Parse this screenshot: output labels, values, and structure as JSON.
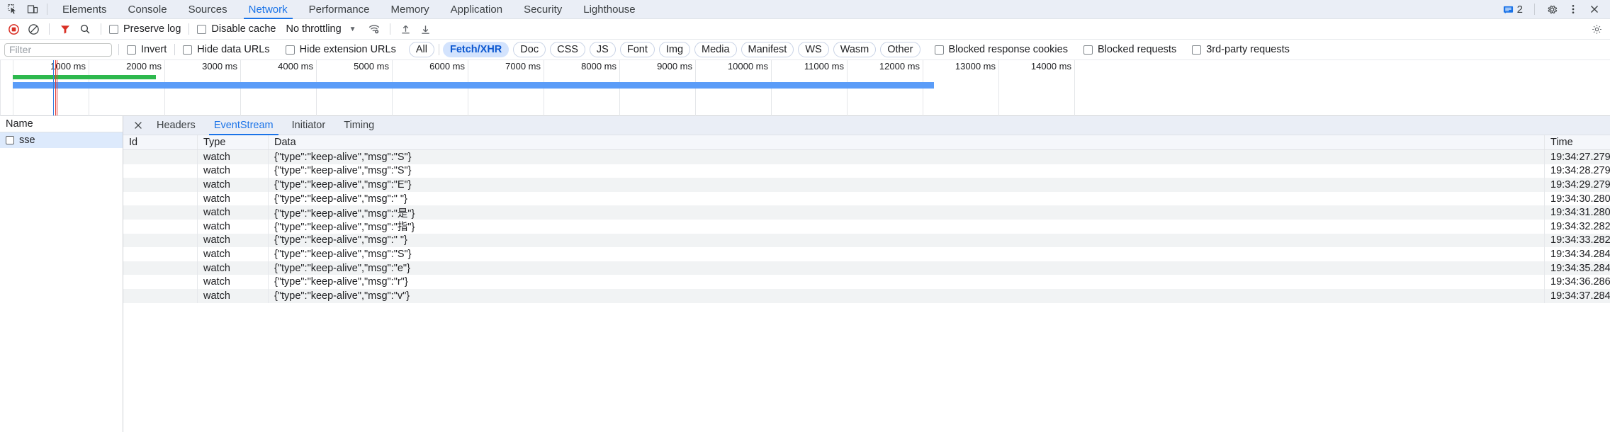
{
  "tabbar": {
    "inspect_icon": "inspect-element-icon",
    "device_icon": "device-toolbar-icon",
    "tabs": [
      {
        "label": "Elements",
        "active": false
      },
      {
        "label": "Console",
        "active": false
      },
      {
        "label": "Sources",
        "active": false
      },
      {
        "label": "Network",
        "active": true
      },
      {
        "label": "Performance",
        "active": false
      },
      {
        "label": "Memory",
        "active": false
      },
      {
        "label": "Application",
        "active": false
      },
      {
        "label": "Security",
        "active": false
      },
      {
        "label": "Lighthouse",
        "active": false
      }
    ],
    "message_count": "2",
    "message_icon": "console-message-icon",
    "settings_icon": "gear-icon",
    "more_icon": "kebab-menu-icon",
    "close_icon": "close-icon"
  },
  "toolbar": {
    "record_icon": "record-stop-icon",
    "clear_icon": "clear-network-log-icon",
    "filter_icon": "filter-icon",
    "search_icon": "search-icon",
    "preserve_log_label": "Preserve log",
    "preserve_log_checked": false,
    "disable_cache_label": "Disable cache",
    "disable_cache_checked": false,
    "throttling_value": "No throttling",
    "throttling_caret": "chevron-down-icon",
    "network_conditions_icon": "wifi-settings-icon",
    "import_icon": "import-har-icon",
    "export_icon": "export-har-icon",
    "settings_icon": "network-settings-gear-icon"
  },
  "filterbar": {
    "filter_value": "",
    "filter_placeholder": "Filter",
    "invert_label": "Invert",
    "invert_checked": false,
    "hide_data_urls_label": "Hide data URLs",
    "hide_data_urls_checked": false,
    "hide_extension_urls_label": "Hide extension URLs",
    "hide_extension_urls_checked": false,
    "types": [
      {
        "label": "All",
        "selected": false
      },
      {
        "label": "Fetch/XHR",
        "selected": true
      },
      {
        "label": "Doc",
        "selected": false
      },
      {
        "label": "CSS",
        "selected": false
      },
      {
        "label": "JS",
        "selected": false
      },
      {
        "label": "Font",
        "selected": false
      },
      {
        "label": "Img",
        "selected": false
      },
      {
        "label": "Media",
        "selected": false
      },
      {
        "label": "Manifest",
        "selected": false
      },
      {
        "label": "WS",
        "selected": false
      },
      {
        "label": "Wasm",
        "selected": false
      },
      {
        "label": "Other",
        "selected": false
      }
    ],
    "blocked_response_cookies_label": "Blocked response cookies",
    "blocked_response_cookies_checked": false,
    "blocked_requests_label": "Blocked requests",
    "blocked_requests_checked": false,
    "third_party_requests_label": "3rd-party requests",
    "third_party_requests_checked": false
  },
  "overview": {
    "ticks": [
      "1000 ms",
      "2000 ms",
      "3000 ms",
      "4000 ms",
      "5000 ms",
      "6000 ms",
      "7000 ms",
      "8000 ms",
      "9000 ms",
      "10000 ms",
      "11000 ms",
      "12000 ms",
      "13000 ms",
      "14000 ms"
    ],
    "colors": {
      "request_bar": "#5a9cf8",
      "received_bar": "#2db84d",
      "dom_content_loaded": "#3b7ddd",
      "load_event": "#e53935"
    }
  },
  "requests": {
    "column_header": "Name",
    "rows": [
      {
        "name": "sse",
        "selected": true,
        "checked": false
      }
    ]
  },
  "detail": {
    "close_icon": "close-icon",
    "tabs": [
      {
        "label": "Headers",
        "active": false
      },
      {
        "label": "EventStream",
        "active": true
      },
      {
        "label": "Initiator",
        "active": false
      },
      {
        "label": "Timing",
        "active": false
      }
    ],
    "columns": [
      "Id",
      "Type",
      "Data",
      "Time"
    ],
    "rows": [
      {
        "id": "",
        "type": "watch",
        "data": "{\"type\":\"keep-alive\",\"msg\":\"S\"}",
        "time": "19:34:27.279"
      },
      {
        "id": "",
        "type": "watch",
        "data": "{\"type\":\"keep-alive\",\"msg\":\"S\"}",
        "time": "19:34:28.279"
      },
      {
        "id": "",
        "type": "watch",
        "data": "{\"type\":\"keep-alive\",\"msg\":\"E\"}",
        "time": "19:34:29.279"
      },
      {
        "id": "",
        "type": "watch",
        "data": "{\"type\":\"keep-alive\",\"msg\":\" \"}",
        "time": "19:34:30.280"
      },
      {
        "id": "",
        "type": "watch",
        "data": "{\"type\":\"keep-alive\",\"msg\":\"是\"}",
        "time": "19:34:31.280"
      },
      {
        "id": "",
        "type": "watch",
        "data": "{\"type\":\"keep-alive\",\"msg\":\"指\"}",
        "time": "19:34:32.282"
      },
      {
        "id": "",
        "type": "watch",
        "data": "{\"type\":\"keep-alive\",\"msg\":\" \"}",
        "time": "19:34:33.282"
      },
      {
        "id": "",
        "type": "watch",
        "data": "{\"type\":\"keep-alive\",\"msg\":\"S\"}",
        "time": "19:34:34.284"
      },
      {
        "id": "",
        "type": "watch",
        "data": "{\"type\":\"keep-alive\",\"msg\":\"e\"}",
        "time": "19:34:35.284"
      },
      {
        "id": "",
        "type": "watch",
        "data": "{\"type\":\"keep-alive\",\"msg\":\"r\"}",
        "time": "19:34:36.286"
      },
      {
        "id": "",
        "type": "watch",
        "data": "{\"type\":\"keep-alive\",\"msg\":\"v\"}",
        "time": "19:34:37.284"
      }
    ]
  }
}
